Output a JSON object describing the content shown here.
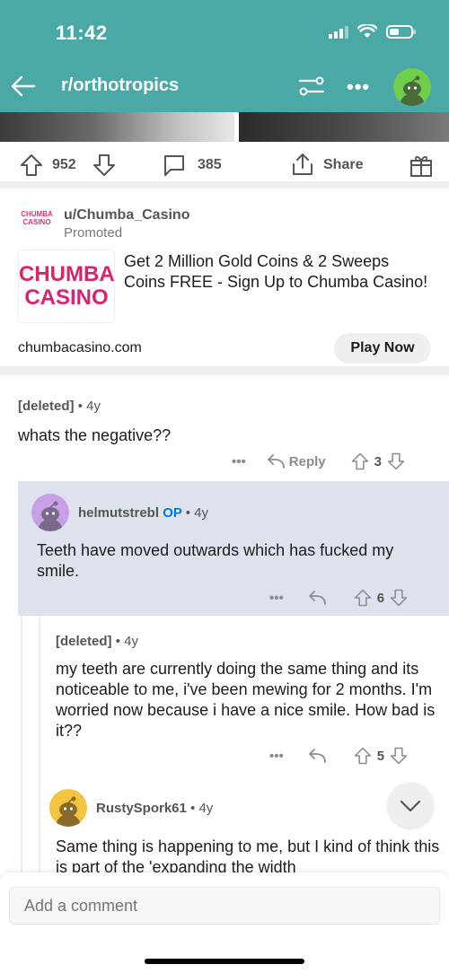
{
  "status": {
    "time": "11:42"
  },
  "nav": {
    "subreddit": "r/orthotropics"
  },
  "post_actions": {
    "upvotes": "952",
    "comments": "385",
    "share": "Share"
  },
  "promo": {
    "logo_small": "CHUMBA CASINO",
    "logo_line1": "CHUMBA",
    "logo_line2": "CASINO",
    "user": "u/Chumba_Casino",
    "tag": "Promoted",
    "text": "Get 2 Million Gold Coins & 2 Sweeps Coins FREE - Sign Up to Chumba Casino!",
    "domain": "chumbacasino.com",
    "cta": "Play Now"
  },
  "comments": [
    {
      "author": "[deleted]",
      "age": "4y",
      "body": "whats the negative??",
      "reply": "Reply",
      "score": "3"
    },
    {
      "author": "helmutstrebl",
      "op": "OP",
      "age": "4y",
      "body": "Teeth have moved outwards which has fucked my smile.",
      "score": "6"
    },
    {
      "author": "[deleted]",
      "age": "4y",
      "body": "my teeth are currently doing the same thing and its noticeable to me, i've been mewing for 2 months. I'm worried now because i have a nice smile. How bad is it??",
      "score": "5"
    },
    {
      "author": "RustySpork61",
      "age": "4y",
      "body": "Same thing is happening to me, but I kind of think this is part of the 'expanding the width"
    }
  ],
  "composer": {
    "placeholder": "Add a comment"
  },
  "colors": {
    "header": "#4aa9a7",
    "op": "#0079d3",
    "highlight": "#dee2ec"
  }
}
